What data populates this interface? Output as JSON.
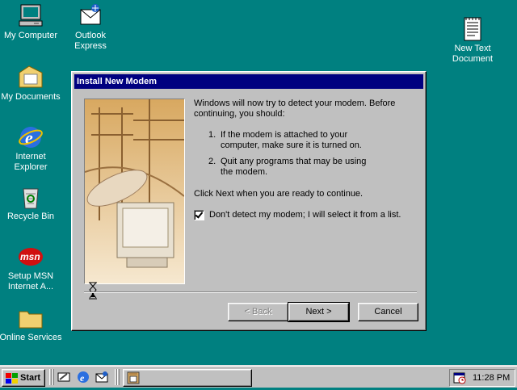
{
  "desktop": {
    "icons": [
      {
        "label": "My Computer"
      },
      {
        "label": "Outlook Express"
      },
      {
        "label": "My Documents"
      },
      {
        "label": "Internet Explorer"
      },
      {
        "label": "Recycle Bin"
      },
      {
        "label": "Setup MSN Internet A..."
      },
      {
        "label": "Online Services"
      },
      {
        "label": "New Text Document"
      }
    ]
  },
  "dialog": {
    "title": "Install New Modem",
    "intro": "Windows will now try to detect your modem.  Before continuing, you should:",
    "steps": [
      {
        "num": "1.",
        "text": "If the modem is attached to your computer, make sure it is turned on."
      },
      {
        "num": "2.",
        "text": "Quit any programs that may be using the modem."
      }
    ],
    "instruction": "Click Next when you are ready to continue.",
    "checkbox": {
      "label": "Don't detect my modem; I will select it from a list.",
      "checked": true
    },
    "buttons": {
      "back": "< Back",
      "next": "Next >",
      "cancel": "Cancel"
    }
  },
  "taskbar": {
    "start": "Start",
    "clock": "11:28 PM"
  },
  "icons": {
    "my_computer": "computer-icon",
    "outlook": "outlook-express-icon",
    "my_documents": "folder-icon",
    "ie": "internet-explorer-icon",
    "recycle": "recycle-bin-icon",
    "msn": "msn-icon",
    "online_services": "folder-icon",
    "text_doc": "text-document-icon",
    "cursor": "hourglass-icon"
  },
  "colors": {
    "desktop": "#008080",
    "titlebar": "#000080",
    "face": "#c0c0c0"
  }
}
